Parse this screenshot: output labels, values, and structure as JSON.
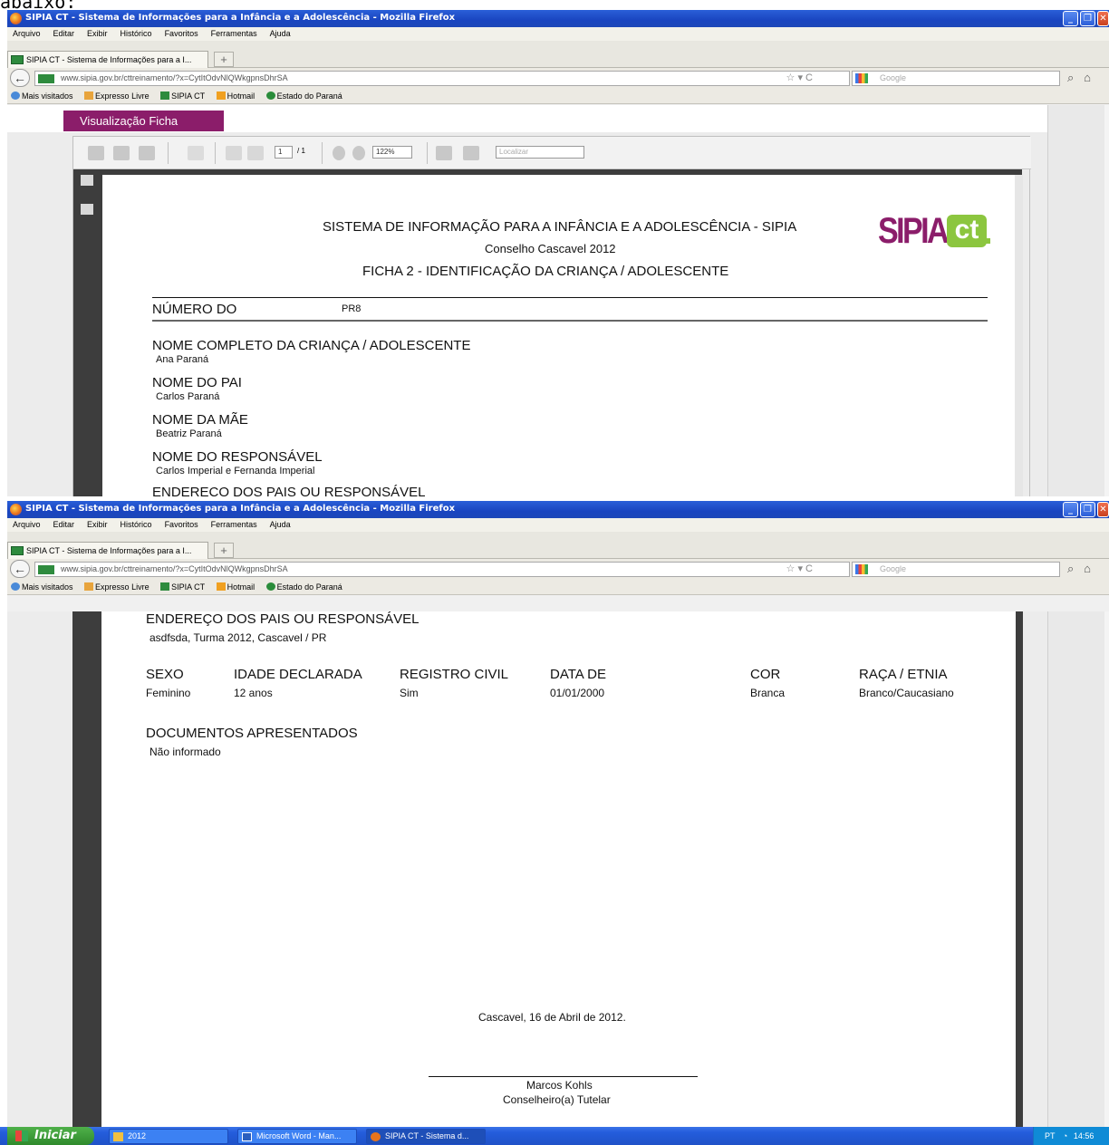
{
  "top_fragment": "abaixo:",
  "window": {
    "title": "SIPIA CT - Sistema de Informações para a Infância e a Adolescência - Mozilla Firefox",
    "menu": [
      "Arquivo",
      "Editar",
      "Exibir",
      "Histórico",
      "Favoritos",
      "Ferramentas",
      "Ajuda"
    ],
    "tab_label": "SIPIA CT - Sistema de Informações para a I...",
    "new_tab": "+",
    "url": "www.sipia.gov.br/cttreinamento/?x=CytItOdvNlQWkgpnsDhrSA",
    "search_placeholder": "Google",
    "bookmarks": [
      "Mais visitados",
      "Expresso Livre",
      "SIPIA CT",
      "Hotmail",
      "Estado do Paraná"
    ]
  },
  "page": {
    "section_tab": "Visualização Ficha",
    "pdf_page_num": "1",
    "pdf_page_total": "/ 1",
    "pdf_zoom": "122%",
    "pdf_find": "Localizar"
  },
  "doc": {
    "header_line1": "SISTEMA DE INFORMAÇÃO PARA A INFÂNCIA E A ADOLESCÊNCIA - SIPIA",
    "header_line2": "Conselho Cascavel 2012",
    "header_line3": "FICHA 2 - IDENTIFICAÇÃO DA CRIANÇA / ADOLESCENTE",
    "logo_text": "SIPIA",
    "logo_ct": "ct",
    "numero_label": "NÚMERO DO",
    "numero_value": "PR8",
    "nome_label": "NOME COMPLETO DA CRIANÇA / ADOLESCENTE",
    "nome_value": "Ana Paraná",
    "pai_label": "NOME DO PAI",
    "pai_value": "Carlos Paraná",
    "mae_label": "NOME DA MÃE",
    "mae_value": "Beatriz Paraná",
    "resp_label": "NOME DO RESPONSÁVEL",
    "resp_value": "Carlos Imperial e Fernanda Imperial",
    "endereco_label": "ENDEREÇO DOS PAIS OU RESPONSÁVEL",
    "endereco_value": "asdfsda, Turma 2012, Cascavel / PR",
    "sexo_label": "SEXO",
    "sexo_value": "Feminino",
    "idade_label": "IDADE DECLARADA",
    "idade_value": "12 anos",
    "registro_label": "REGISTRO CIVIL",
    "registro_value": "Sim",
    "data_label": "DATA DE",
    "data_value": "01/01/2000",
    "cor_label": "COR",
    "cor_value": "Branca",
    "raca_label": "RAÇA / ETNIA",
    "raca_value": "Branco/Caucasiano",
    "docs_label": "DOCUMENTOS APRESENTADOS",
    "docs_value": "Não informado",
    "place_date": "Cascavel, 16 de Abril de 2012.",
    "signer_name": "Marcos Kohls",
    "signer_role": "Conselheiro(a) Tutelar"
  },
  "taskbar": {
    "start": "Iniciar",
    "items": [
      "2012",
      "Microsoft Word - Man...",
      "SIPIA CT - Sistema d..."
    ],
    "tray": "PT",
    "clock": "14:56"
  },
  "colors": {
    "accent": "#8b1d6a",
    "logo_green": "#8cc63f",
    "titlebar": "#1a45c0"
  }
}
